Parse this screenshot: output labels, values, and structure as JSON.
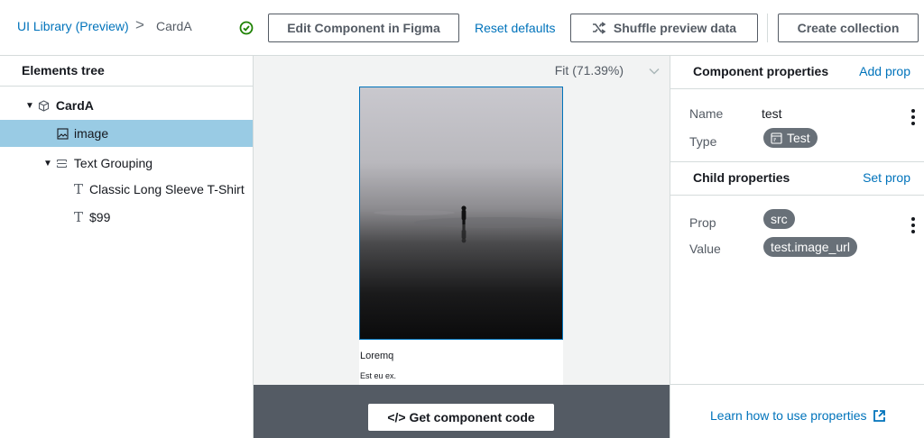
{
  "breadcrumb": {
    "root": "UI Library (Preview)",
    "separator": ">",
    "current": "CardA"
  },
  "toolbar": {
    "edit_label": "Edit Component in Figma",
    "reset_label": "Reset defaults",
    "shuffle_label": "Shuffle preview data",
    "create_label": "Create collection"
  },
  "tree": {
    "title": "Elements tree",
    "items": [
      {
        "label": "CardA",
        "icon": "cube-icon",
        "depth": 0,
        "expanded": true,
        "selected": false
      },
      {
        "label": "image",
        "icon": "image-icon",
        "depth": 1,
        "selected": true
      },
      {
        "label": "Text Grouping",
        "icon": "group-icon",
        "depth": 1,
        "expanded": true,
        "selected": false
      },
      {
        "label": "Classic Long Sleeve T-Shirt",
        "icon": "text-icon",
        "depth": 2,
        "selected": false
      },
      {
        "label": "$99",
        "icon": "text-icon",
        "depth": 2,
        "selected": false
      }
    ]
  },
  "canvas": {
    "zoom_label": "Fit (71.39%)",
    "card_title": "Loremq",
    "card_subtitle": "Est eu ex.",
    "code_button": "</> Get component code"
  },
  "component_properties": {
    "title": "Component properties",
    "action": "Add prop",
    "name_label": "Name",
    "name_value": "test",
    "type_label": "Type",
    "type_value": "Test"
  },
  "child_properties": {
    "title": "Child properties",
    "action": "Set prop",
    "prop_label": "Prop",
    "prop_value": "src",
    "value_label": "Value",
    "value_value": "test.image_url"
  },
  "footer": {
    "learn_link": "Learn how to use properties"
  },
  "colors": {
    "link": "#0073bb",
    "selected": "#99cbe4",
    "success": "#1d8102",
    "pill": "#687078",
    "code_bar": "#545b64"
  }
}
